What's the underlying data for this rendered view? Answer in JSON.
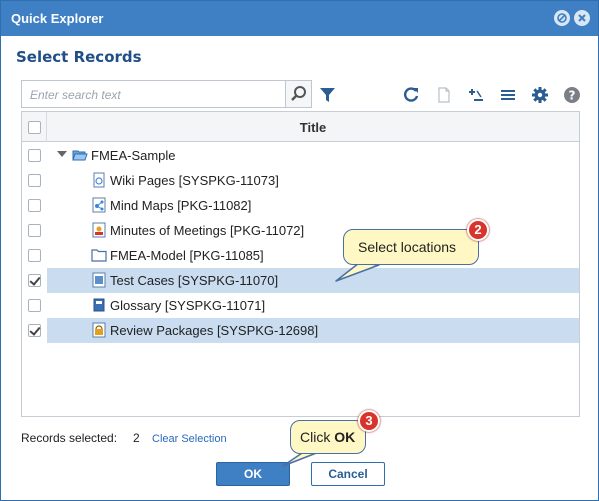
{
  "window": {
    "title": "Quick Explorer"
  },
  "heading": "Select Records",
  "search": {
    "placeholder": "Enter search text"
  },
  "grid": {
    "column_title": "Title",
    "root": {
      "label": "FMEA-Sample",
      "checked": false
    },
    "rows": [
      {
        "label": "Wiki Pages [SYSPKG-11073]",
        "checked": false,
        "selected": false,
        "icon": "wiki-pages-icon"
      },
      {
        "label": "Mind Maps [PKG-11082]",
        "checked": false,
        "selected": false,
        "icon": "mind-map-icon"
      },
      {
        "label": "Minutes of Meetings [PKG-11072]",
        "checked": false,
        "selected": false,
        "icon": "meeting-minutes-icon"
      },
      {
        "label": "FMEA-Model [PKG-11085]",
        "checked": false,
        "selected": false,
        "icon": "folder-icon"
      },
      {
        "label": "Test Cases [SYSPKG-11070]",
        "checked": true,
        "selected": true,
        "icon": "test-cases-icon"
      },
      {
        "label": "Glossary [SYSPKG-11071]",
        "checked": false,
        "selected": false,
        "icon": "glossary-icon"
      },
      {
        "label": "Review Packages [SYSPKG-12698]",
        "checked": true,
        "selected": true,
        "icon": "review-package-icon"
      }
    ]
  },
  "footer": {
    "records_label": "Records selected:",
    "records_count": "2",
    "clear_selection": "Clear Selection"
  },
  "buttons": {
    "ok": "OK",
    "cancel": "Cancel"
  },
  "callouts": {
    "select_locations": {
      "text": "Select locations",
      "step": "2"
    },
    "click_ok": {
      "prefix": "Click ",
      "bold": "OK",
      "step": "3"
    }
  },
  "colors": {
    "titlebar": "#3f7fc3",
    "selection": "#c9dcf0",
    "callout_fill": "#fff8c4",
    "step_badge": "#d9342b"
  }
}
